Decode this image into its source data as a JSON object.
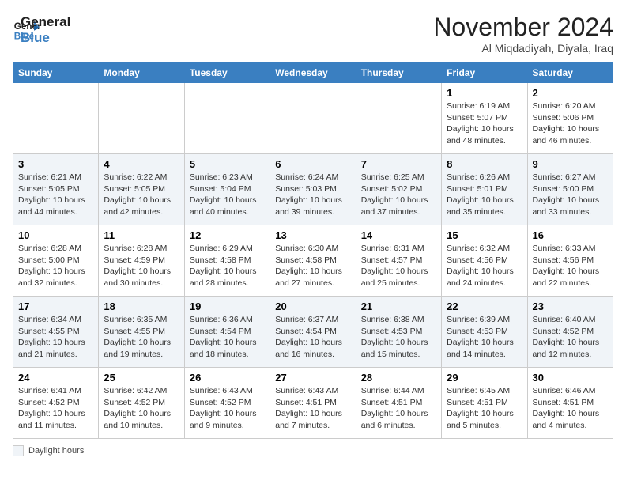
{
  "logo": {
    "line1": "General",
    "line2": "Blue"
  },
  "title": "November 2024",
  "location": "Al Miqdadiyah, Diyala, Iraq",
  "days_header": [
    "Sunday",
    "Monday",
    "Tuesday",
    "Wednesday",
    "Thursday",
    "Friday",
    "Saturday"
  ],
  "weeks": [
    [
      {
        "num": "",
        "info": ""
      },
      {
        "num": "",
        "info": ""
      },
      {
        "num": "",
        "info": ""
      },
      {
        "num": "",
        "info": ""
      },
      {
        "num": "",
        "info": ""
      },
      {
        "num": "1",
        "info": "Sunrise: 6:19 AM\nSunset: 5:07 PM\nDaylight: 10 hours and 48 minutes."
      },
      {
        "num": "2",
        "info": "Sunrise: 6:20 AM\nSunset: 5:06 PM\nDaylight: 10 hours and 46 minutes."
      }
    ],
    [
      {
        "num": "3",
        "info": "Sunrise: 6:21 AM\nSunset: 5:05 PM\nDaylight: 10 hours and 44 minutes."
      },
      {
        "num": "4",
        "info": "Sunrise: 6:22 AM\nSunset: 5:05 PM\nDaylight: 10 hours and 42 minutes."
      },
      {
        "num": "5",
        "info": "Sunrise: 6:23 AM\nSunset: 5:04 PM\nDaylight: 10 hours and 40 minutes."
      },
      {
        "num": "6",
        "info": "Sunrise: 6:24 AM\nSunset: 5:03 PM\nDaylight: 10 hours and 39 minutes."
      },
      {
        "num": "7",
        "info": "Sunrise: 6:25 AM\nSunset: 5:02 PM\nDaylight: 10 hours and 37 minutes."
      },
      {
        "num": "8",
        "info": "Sunrise: 6:26 AM\nSunset: 5:01 PM\nDaylight: 10 hours and 35 minutes."
      },
      {
        "num": "9",
        "info": "Sunrise: 6:27 AM\nSunset: 5:00 PM\nDaylight: 10 hours and 33 minutes."
      }
    ],
    [
      {
        "num": "10",
        "info": "Sunrise: 6:28 AM\nSunset: 5:00 PM\nDaylight: 10 hours and 32 minutes."
      },
      {
        "num": "11",
        "info": "Sunrise: 6:28 AM\nSunset: 4:59 PM\nDaylight: 10 hours and 30 minutes."
      },
      {
        "num": "12",
        "info": "Sunrise: 6:29 AM\nSunset: 4:58 PM\nDaylight: 10 hours and 28 minutes."
      },
      {
        "num": "13",
        "info": "Sunrise: 6:30 AM\nSunset: 4:58 PM\nDaylight: 10 hours and 27 minutes."
      },
      {
        "num": "14",
        "info": "Sunrise: 6:31 AM\nSunset: 4:57 PM\nDaylight: 10 hours and 25 minutes."
      },
      {
        "num": "15",
        "info": "Sunrise: 6:32 AM\nSunset: 4:56 PM\nDaylight: 10 hours and 24 minutes."
      },
      {
        "num": "16",
        "info": "Sunrise: 6:33 AM\nSunset: 4:56 PM\nDaylight: 10 hours and 22 minutes."
      }
    ],
    [
      {
        "num": "17",
        "info": "Sunrise: 6:34 AM\nSunset: 4:55 PM\nDaylight: 10 hours and 21 minutes."
      },
      {
        "num": "18",
        "info": "Sunrise: 6:35 AM\nSunset: 4:55 PM\nDaylight: 10 hours and 19 minutes."
      },
      {
        "num": "19",
        "info": "Sunrise: 6:36 AM\nSunset: 4:54 PM\nDaylight: 10 hours and 18 minutes."
      },
      {
        "num": "20",
        "info": "Sunrise: 6:37 AM\nSunset: 4:54 PM\nDaylight: 10 hours and 16 minutes."
      },
      {
        "num": "21",
        "info": "Sunrise: 6:38 AM\nSunset: 4:53 PM\nDaylight: 10 hours and 15 minutes."
      },
      {
        "num": "22",
        "info": "Sunrise: 6:39 AM\nSunset: 4:53 PM\nDaylight: 10 hours and 14 minutes."
      },
      {
        "num": "23",
        "info": "Sunrise: 6:40 AM\nSunset: 4:52 PM\nDaylight: 10 hours and 12 minutes."
      }
    ],
    [
      {
        "num": "24",
        "info": "Sunrise: 6:41 AM\nSunset: 4:52 PM\nDaylight: 10 hours and 11 minutes."
      },
      {
        "num": "25",
        "info": "Sunrise: 6:42 AM\nSunset: 4:52 PM\nDaylight: 10 hours and 10 minutes."
      },
      {
        "num": "26",
        "info": "Sunrise: 6:43 AM\nSunset: 4:52 PM\nDaylight: 10 hours and 9 minutes."
      },
      {
        "num": "27",
        "info": "Sunrise: 6:43 AM\nSunset: 4:51 PM\nDaylight: 10 hours and 7 minutes."
      },
      {
        "num": "28",
        "info": "Sunrise: 6:44 AM\nSunset: 4:51 PM\nDaylight: 10 hours and 6 minutes."
      },
      {
        "num": "29",
        "info": "Sunrise: 6:45 AM\nSunset: 4:51 PM\nDaylight: 10 hours and 5 minutes."
      },
      {
        "num": "30",
        "info": "Sunrise: 6:46 AM\nSunset: 4:51 PM\nDaylight: 10 hours and 4 minutes."
      }
    ]
  ],
  "legend": {
    "label": "Daylight hours"
  }
}
